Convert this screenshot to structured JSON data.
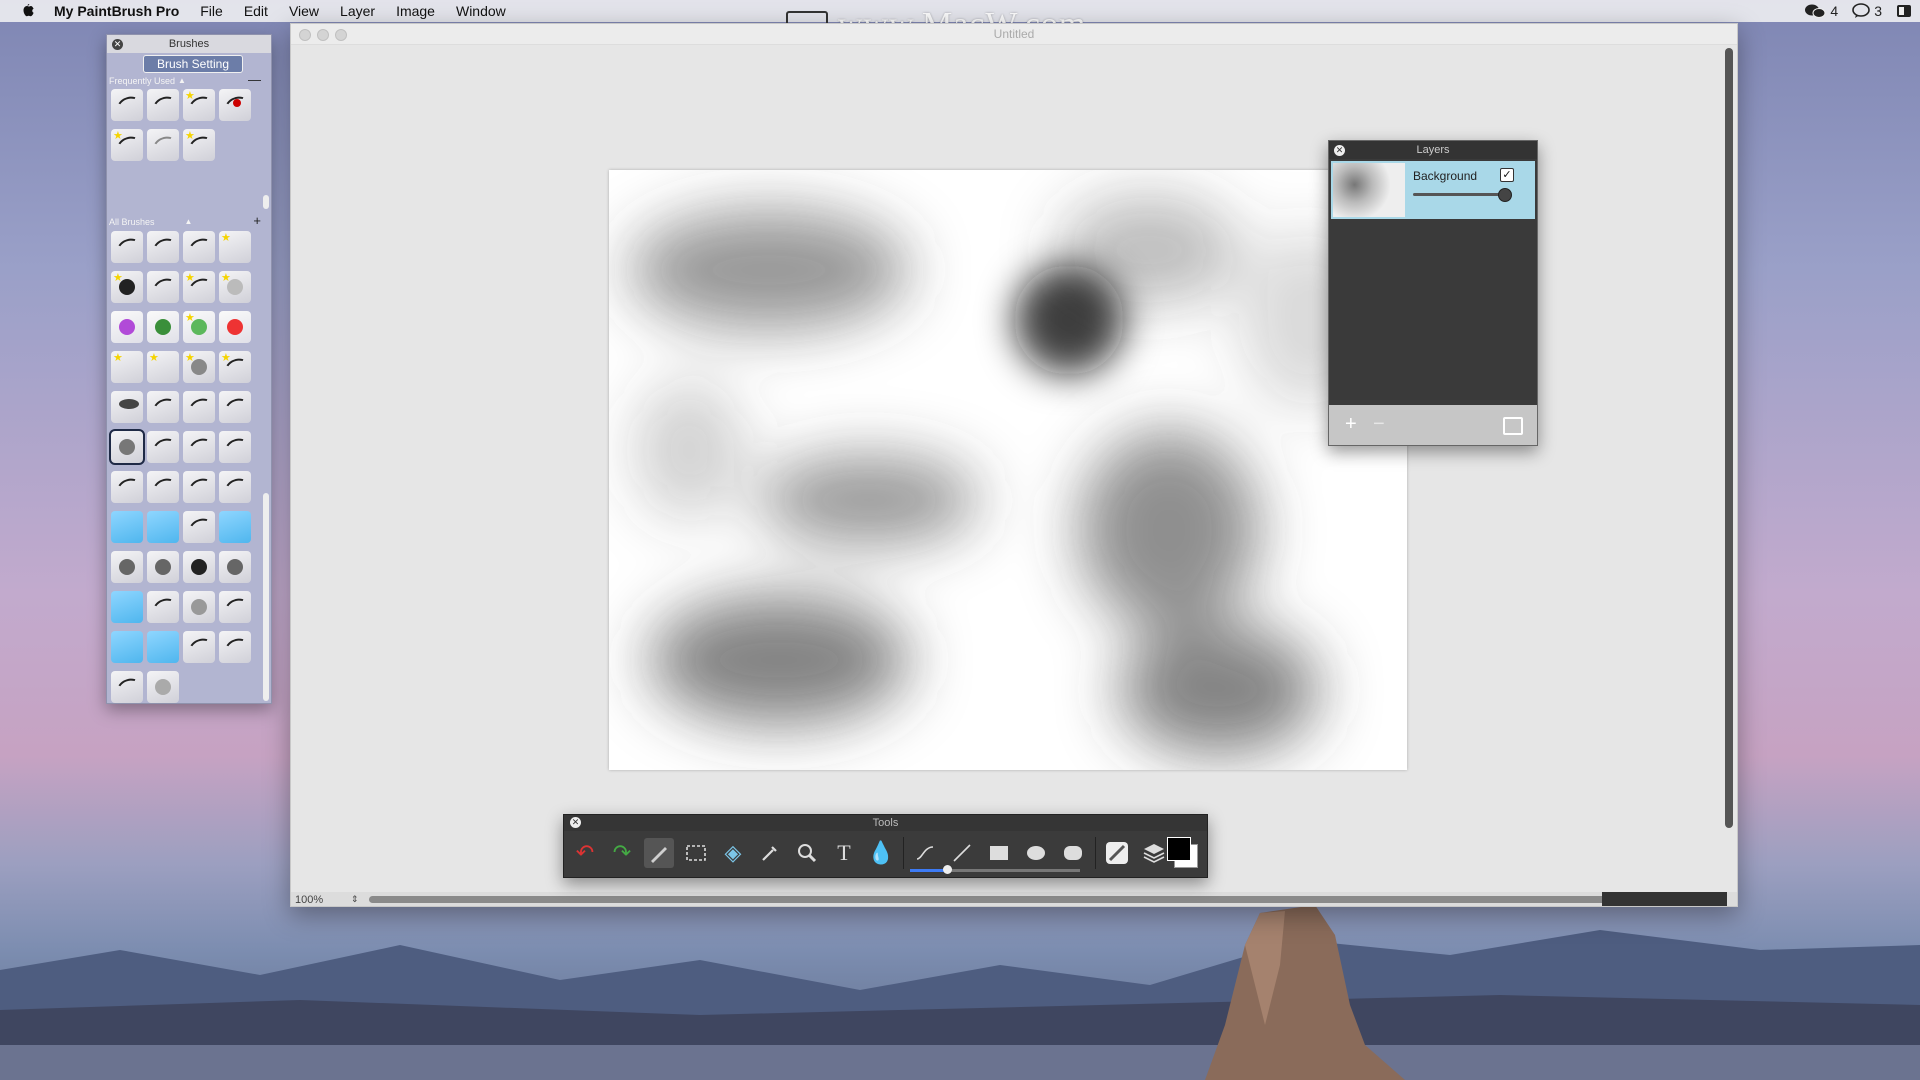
{
  "menubar": {
    "app_name": "My PaintBrush Pro",
    "items": [
      "File",
      "Edit",
      "View",
      "Layer",
      "Image",
      "Window"
    ],
    "wechat_count": "4",
    "messages_count": "3"
  },
  "watermark": "www.MacW.com",
  "main_window": {
    "doc_title": "Untitled",
    "zoom": "100%"
  },
  "brushes_panel": {
    "title": "Brushes",
    "brush_setting_label": "Brush Setting",
    "frequently_used_label": "Frequently Used",
    "all_brushes_label": "All Brushes"
  },
  "layers_panel": {
    "title": "Layers",
    "layer_name": "Background",
    "layer_visible": true,
    "opacity": 0.95
  },
  "tools_panel": {
    "title": "Tools",
    "brush_size": 0.22,
    "foreground_color": "#000000",
    "background_color": "#ffffff"
  },
  "icons": [
    "apple-icon",
    "wechat-icon",
    "messages-icon",
    "screen-icon",
    "undo-icon",
    "redo-icon",
    "brush-tool-icon",
    "marquee-icon",
    "fill-bucket-icon",
    "eyedropper-icon",
    "zoom-icon",
    "text-tool-icon",
    "water-drop-icon",
    "curve-icon",
    "line-icon",
    "rectangle-icon",
    "ellipse-icon",
    "rounded-rect-icon",
    "brush-select-icon",
    "layers-icon"
  ]
}
